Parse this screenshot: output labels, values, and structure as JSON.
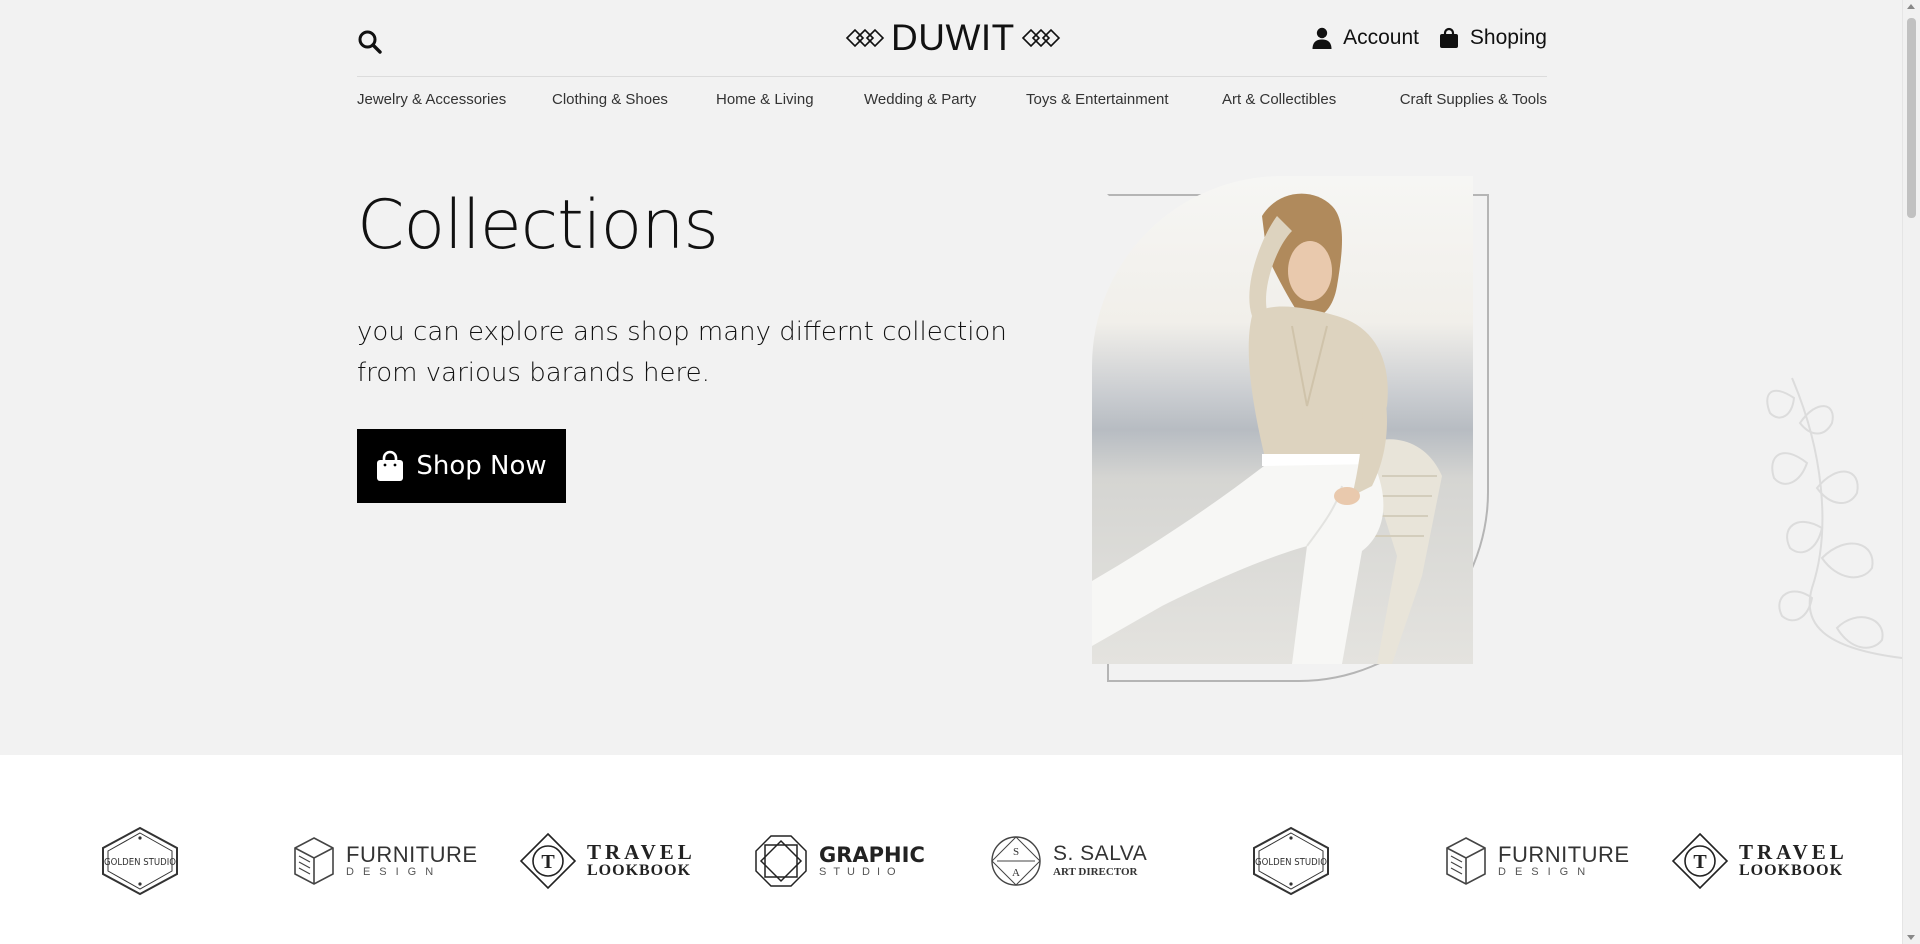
{
  "header": {
    "logo_text": "DUWIT",
    "account_label": "Account",
    "shopping_label": "Shoping"
  },
  "nav": {
    "items": [
      "Jewelry & Accessories",
      "Clothing & Shoes",
      "Home & Living",
      "Wedding & Party",
      "Toys & Entertainment",
      "Art & Collectibles",
      "Craft Supplies & Tools"
    ]
  },
  "hero": {
    "title": "Collections",
    "subtitle": "you can explore ans shop many differnt collection from various barands here.",
    "button_label": "Shop Now"
  },
  "brands": {
    "items": [
      {
        "icon": "golden-studio-badge",
        "text": "GOLDEN STUDIO"
      },
      {
        "icon": "furniture-cube",
        "word": "FURNITURE",
        "sub": "DESIGN"
      },
      {
        "icon": "travel-t-diamond",
        "word": "TRAVEL",
        "sub": "LOOKBOOK"
      },
      {
        "icon": "graphic-octagon",
        "word": "GRAPHIC",
        "sub": "STUDIO"
      },
      {
        "icon": "salva-circle",
        "word": "S. SALVA",
        "sub": "ART DIRECTOR",
        "monogram_top": "S",
        "monogram_bottom": "A"
      },
      {
        "icon": "golden-studio-badge",
        "text": "GOLDEN STUDIO"
      },
      {
        "icon": "furniture-cube",
        "word": "FURNITURE",
        "sub": "DESIGN"
      },
      {
        "icon": "travel-t-diamond",
        "word": "TRAVEL",
        "sub": "LOOKBOOK"
      }
    ],
    "travel_monogram": "T"
  },
  "colors": {
    "background": "#f2f2f2",
    "button": "#000000",
    "brand_strip": "#ffffff"
  }
}
